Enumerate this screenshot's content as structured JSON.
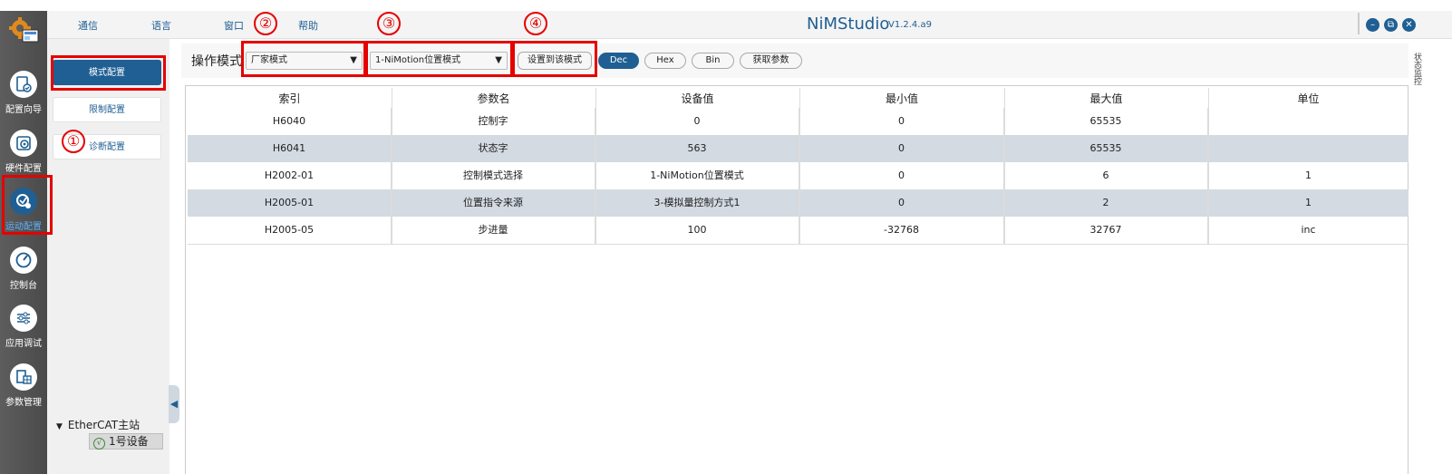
{
  "titlebar": {
    "menus": [
      "通信",
      "语言",
      "窗口",
      "帮助"
    ],
    "app_name": "NiMStudio",
    "version": "V1.2.4.a9",
    "minimize": "–",
    "restore": "⧉",
    "close": "✕"
  },
  "rail": {
    "items": [
      {
        "label": "配置向导",
        "icon": "wizard-icon"
      },
      {
        "label": "硬件配置",
        "icon": "hardware-gear-icon"
      },
      {
        "label": "运动配置",
        "icon": "motion-config-icon"
      },
      {
        "label": "控制台",
        "icon": "gauge-icon"
      },
      {
        "label": "应用调试",
        "icon": "sliders-icon"
      },
      {
        "label": "参数管理",
        "icon": "param-manage-icon"
      }
    ],
    "active_index": 2,
    "active_color": "#1f5f93"
  },
  "subnav": {
    "items": [
      {
        "label": "模式配置"
      },
      {
        "label": "限制配置"
      },
      {
        "label": "诊断配置"
      }
    ],
    "active_index": 0
  },
  "tree": {
    "root": "EtherCAT主站",
    "root_toggle": "▼",
    "device": "1号设备",
    "device_status": "√"
  },
  "toolbar": {
    "op_mode_label": "操作模式",
    "factory_combo": "厂家模式",
    "mode_combo": "1-NiMotion位置模式",
    "combo_arrow": "▼",
    "apply_button": "设置到该模式",
    "radix": [
      "Dec",
      "Hex",
      "Bin"
    ],
    "radix_active": "Dec",
    "fetch_button": "获取参数"
  },
  "table": {
    "headers": [
      "索引",
      "参数名",
      "设备值",
      "最小值",
      "最大值",
      "单位"
    ],
    "rows": [
      [
        "H6040",
        "控制字",
        "0",
        "0",
        "65535",
        ""
      ],
      [
        "H6041",
        "状态字",
        "563",
        "0",
        "65535",
        ""
      ],
      [
        "H2002-01",
        "控制模式选择",
        "1-NiMotion位置模式",
        "0",
        "6",
        "1"
      ],
      [
        "H2005-01",
        "位置指令来源",
        "3-模拟量控制方式1",
        "0",
        "2",
        "1"
      ],
      [
        "H2005-05",
        "步进量",
        "100",
        "-32768",
        "32767",
        "inc"
      ]
    ],
    "alt_row_color": "#d3dae2"
  },
  "right_panel": {
    "label": "状态监控"
  },
  "annotations": {
    "badges": [
      "①",
      "②",
      "③",
      "④"
    ],
    "color": "#e60000"
  },
  "collapse": {
    "label": "◀"
  }
}
